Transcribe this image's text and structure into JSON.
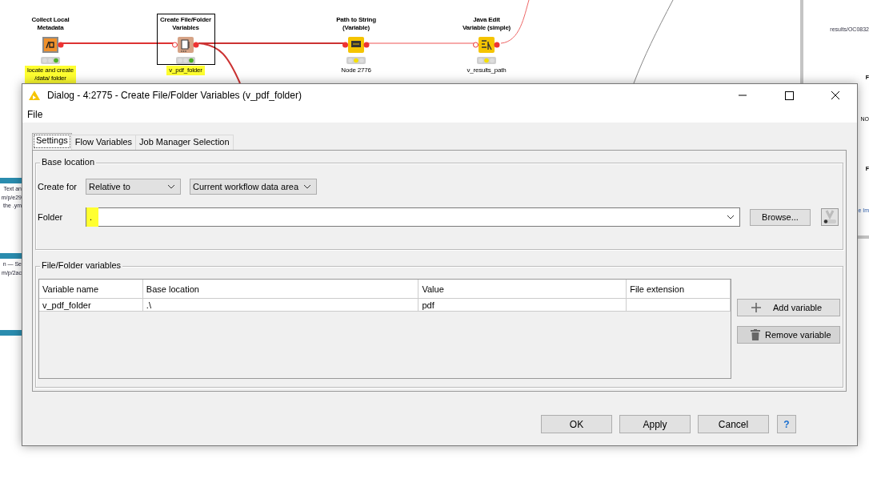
{
  "workflow": {
    "nodes": [
      {
        "title": "Collect Local\nMetadata",
        "label": "locate and create\n/data/ folder",
        "kind": "metadata",
        "executed": true,
        "selected": false,
        "highlighted": true
      },
      {
        "title": "Create File/Folder\nVariables",
        "label": "v_pdf_folder",
        "kind": "file-variables",
        "executed": true,
        "selected": true,
        "highlighted": true
      },
      {
        "title": "Path to String\n(Variable)",
        "label": "Node 2776",
        "kind": "path-to-string",
        "executed": false,
        "selected": false,
        "highlighted": false
      },
      {
        "title": "Java Edit\nVariable (simple)",
        "label": "v_results_path",
        "kind": "java-edit",
        "executed": false,
        "selected": false,
        "highlighted": false
      }
    ],
    "left_notes": [
      {
        "lines": [
          "Text an",
          "m/p/e29",
          "the .ym"
        ]
      },
      {
        "lines": [
          "n — Se",
          "m/p/2ac"
        ]
      }
    ],
    "right_notes": [
      {
        "text": "results/OC0832",
        "kind": "path"
      },
      {
        "text": "F",
        "kind": "bold"
      },
      {
        "text": "NO",
        "kind": "plain"
      },
      {
        "text": "F",
        "kind": "bold"
      },
      {
        "text": "e Im",
        "kind": "link"
      }
    ]
  },
  "dialog": {
    "title": "Dialog - 4:2775 - Create File/Folder Variables (v_pdf_folder)",
    "menu": [
      "File"
    ],
    "tabs": [
      {
        "label": "Settings",
        "selected": true
      },
      {
        "label": "Flow Variables",
        "selected": false
      },
      {
        "label": "Job Manager Selection",
        "selected": false
      }
    ],
    "base_location": {
      "legend": "Base location",
      "create_for_label": "Create for",
      "create_for": "Relative to",
      "relative_target": "Current workflow data area",
      "folder_label": "Folder",
      "folder": ".",
      "folder_highlighted": true,
      "browse": "Browse..."
    },
    "variables": {
      "legend": "File/Folder variables",
      "columns": [
        "Variable name",
        "Base location",
        "Value",
        "File extension"
      ],
      "rows": [
        [
          "v_pdf_folder",
          ".\\",
          "pdf",
          ""
        ]
      ],
      "add": "Add variable",
      "remove": "Remove variable"
    },
    "buttons": [
      "OK",
      "Apply",
      "Cancel"
    ],
    "help": "?"
  }
}
